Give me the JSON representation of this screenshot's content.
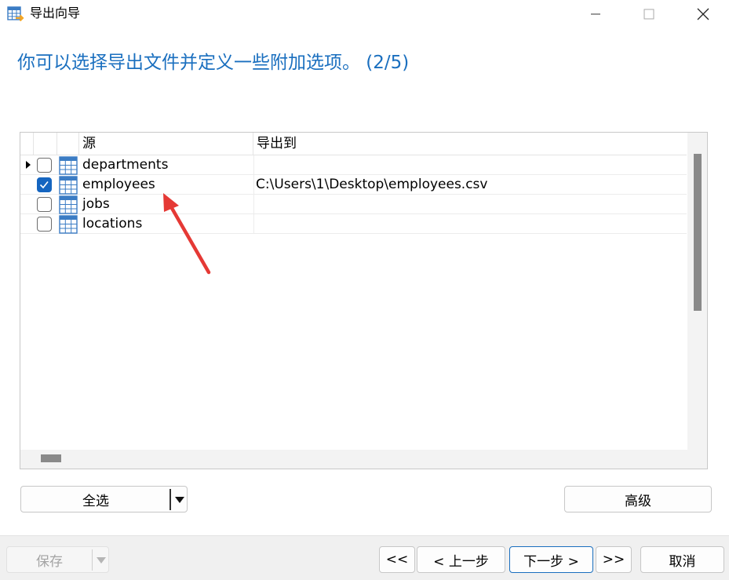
{
  "window": {
    "title": "导出向导"
  },
  "heading": "你可以选择导出文件并定义一些附加选项。 (2/5)",
  "grid": {
    "columns": [
      "源",
      "导出到"
    ],
    "rows": [
      {
        "source": "departments",
        "target": "",
        "checked": false,
        "current": true
      },
      {
        "source": "employees",
        "target": "C:\\Users\\1\\Desktop\\employees.csv",
        "checked": true,
        "current": false
      },
      {
        "source": "jobs",
        "target": "",
        "checked": false,
        "current": false
      },
      {
        "source": "locations",
        "target": "",
        "checked": false,
        "current": false
      }
    ]
  },
  "buttons": {
    "select_all": "全选",
    "advanced": "高级",
    "save": "保存",
    "first": "<<",
    "prev": "< 上一步",
    "next": "下一步 >",
    "last": ">>",
    "cancel": "取消"
  },
  "colors": {
    "accent": "#1a6fbf",
    "annotation": "#e53935"
  },
  "icons": {
    "app": "table-export-icon",
    "table": "table-icon",
    "minimize": "minimize-icon",
    "maximize": "maximize-icon",
    "close": "close-icon"
  }
}
